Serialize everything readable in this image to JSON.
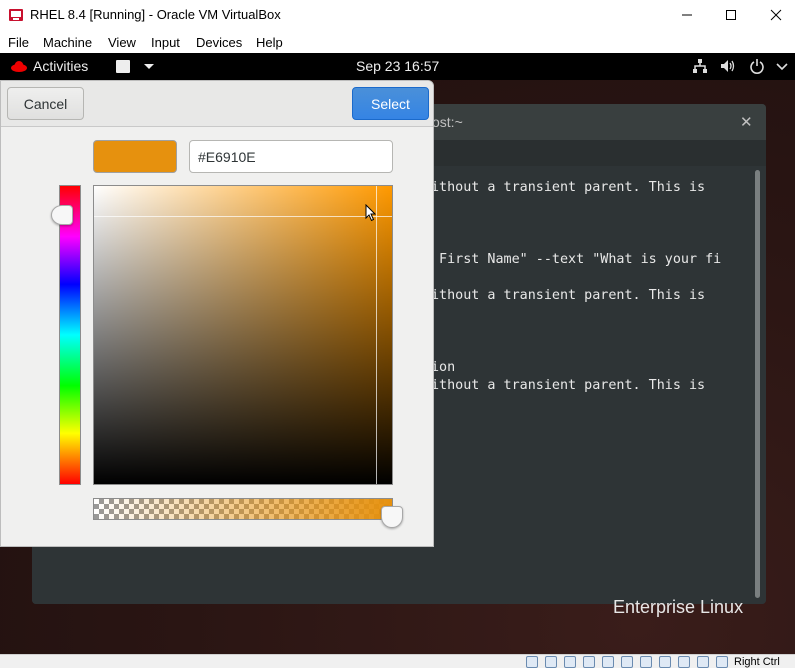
{
  "host_window": {
    "title": "RHEL 8.4 [Running] - Oracle VM VirtualBox",
    "menu": [
      "File",
      "Machine",
      "View",
      "Input",
      "Devices",
      "Help"
    ],
    "host_key": "Right Ctrl"
  },
  "gnome": {
    "activities": "Activities",
    "clock": "Sep 23  16:57",
    "tray_icons": [
      "network-icon",
      "volume-icon",
      "power-icon",
      "chevron-down-icon"
    ]
  },
  "terminal": {
    "title": "ost:~",
    "lines": [
      "ithout a transient parent. This is",
      " First Name\" --text \"What is your fi",
      "ithout a transient parent. This is",
      "ion",
      "ithout a transient parent. This is"
    ]
  },
  "desktop": {
    "brand_text": "Enterprise Linux"
  },
  "color_dialog": {
    "cancel_label": "Cancel",
    "select_label": "Select",
    "hex_value": "#E6910E",
    "current_color": "#E6910E",
    "hue_color": "#FF9900",
    "saturation": 0.94,
    "value": 0.9,
    "hue_position": 0.1,
    "alpha": 1.0
  },
  "colors": {
    "select_blue": "#3584E4",
    "terminal_bg": "#2E3436",
    "gnome_bar": "#000000"
  }
}
